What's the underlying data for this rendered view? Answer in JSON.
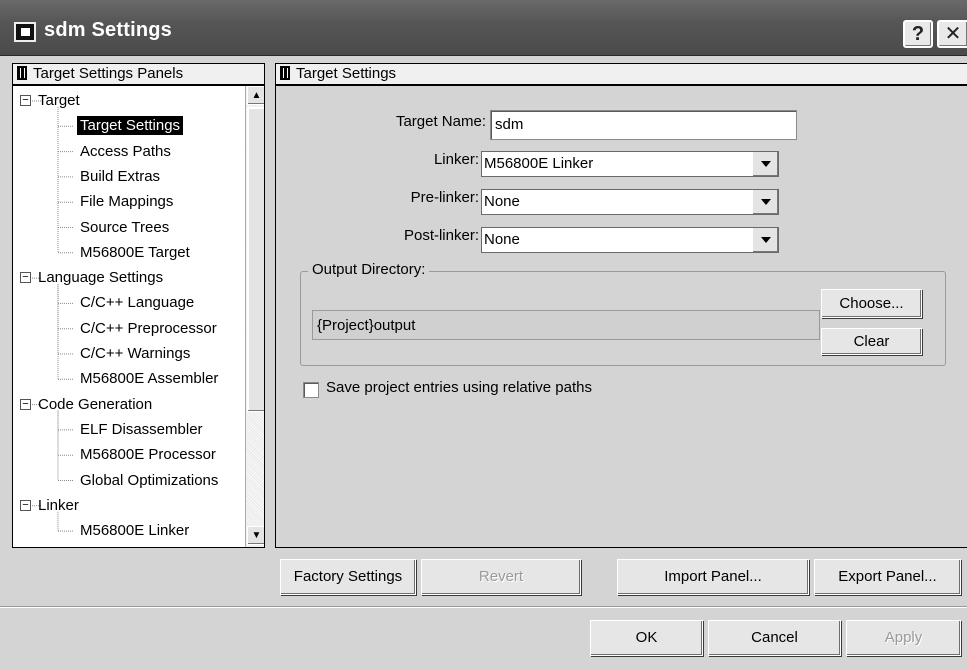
{
  "window": {
    "title": "sdm Settings",
    "help_label": "?",
    "close_label": "✕"
  },
  "left_panel": {
    "header": "Target Settings Panels",
    "tree": [
      {
        "label": "Target",
        "level": 0,
        "expanded": true
      },
      {
        "label": "Target Settings",
        "level": 1,
        "selected": true
      },
      {
        "label": "Access Paths",
        "level": 1
      },
      {
        "label": "Build Extras",
        "level": 1
      },
      {
        "label": "File Mappings",
        "level": 1
      },
      {
        "label": "Source Trees",
        "level": 1
      },
      {
        "label": "M56800E Target",
        "level": 1
      },
      {
        "label": "Language Settings",
        "level": 0,
        "expanded": true
      },
      {
        "label": "C/C++ Language",
        "level": 1
      },
      {
        "label": "C/C++ Preprocessor",
        "level": 1
      },
      {
        "label": "C/C++ Warnings",
        "level": 1
      },
      {
        "label": "M56800E Assembler",
        "level": 1
      },
      {
        "label": "Code Generation",
        "level": 0,
        "expanded": true
      },
      {
        "label": "ELF Disassembler",
        "level": 1
      },
      {
        "label": "M56800E Processor",
        "level": 1
      },
      {
        "label": "Global Optimizations",
        "level": 1
      },
      {
        "label": "Linker",
        "level": 0,
        "expanded": true
      },
      {
        "label": "M56800E Linker",
        "level": 1
      }
    ]
  },
  "right_panel": {
    "header": "Target Settings",
    "target_name_label": "Target Name:",
    "target_name_value": "sdm",
    "linker_label": "Linker:",
    "linker_value": "M56800E Linker",
    "prelinker_label": "Pre-linker:",
    "prelinker_value": "None",
    "postlinker_label": "Post-linker:",
    "postlinker_value": "None",
    "output_directory_label": "Output Directory:",
    "output_directory_value": "{Project}output",
    "choose_label": "Choose...",
    "clear_label": "Clear",
    "relative_paths_label": "Save project entries using relative paths",
    "relative_paths_checked": false
  },
  "panel_buttons": {
    "factory_settings": "Factory Settings",
    "revert": "Revert",
    "import_panel": "Import Panel...",
    "export_panel": "Export Panel..."
  },
  "dialog_buttons": {
    "ok": "OK",
    "cancel": "Cancel",
    "apply": "Apply"
  }
}
